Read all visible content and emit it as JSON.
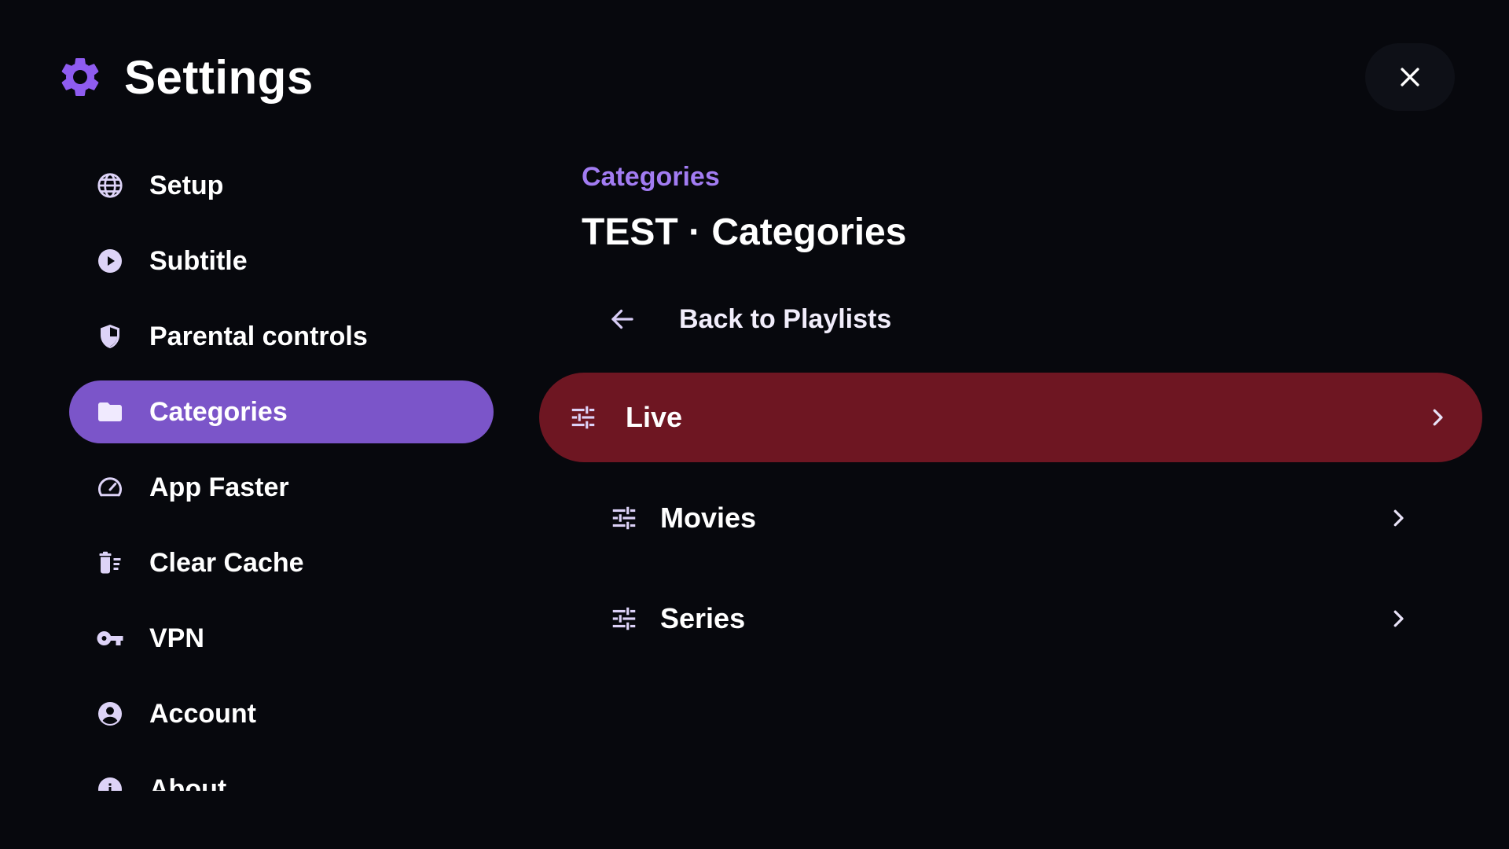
{
  "header": {
    "title": "Settings",
    "icon": "gear-icon",
    "accent_color": "#8f5cf0"
  },
  "close_button": {
    "icon": "close-icon"
  },
  "sidebar": {
    "active_color": "#7b55c9",
    "items": [
      {
        "label": "Setup",
        "icon": "globe-icon",
        "active": false
      },
      {
        "label": "Subtitle",
        "icon": "play-circle-icon",
        "active": false
      },
      {
        "label": "Parental controls",
        "icon": "shield-icon",
        "active": false
      },
      {
        "label": "Categories",
        "icon": "folder-icon",
        "active": true
      },
      {
        "label": "App Faster",
        "icon": "speedometer-icon",
        "active": false
      },
      {
        "label": "Clear Cache",
        "icon": "delete-sweep-icon",
        "active": false
      },
      {
        "label": "VPN",
        "icon": "key-icon",
        "active": false
      },
      {
        "label": "Account",
        "icon": "account-circle-icon",
        "active": false
      },
      {
        "label": "About",
        "icon": "info-icon",
        "active": false
      }
    ]
  },
  "main": {
    "eyebrow": "Categories",
    "title": "TEST · Categories",
    "back_link": {
      "label": "Back to Playlists",
      "icon": "arrow-left-icon"
    },
    "focus_color": "#6e1622",
    "categories": [
      {
        "label": "Live",
        "icon": "tune-icon",
        "focused": true
      },
      {
        "label": "Movies",
        "icon": "tune-icon",
        "focused": false
      },
      {
        "label": "Series",
        "icon": "tune-icon",
        "focused": false
      }
    ]
  }
}
